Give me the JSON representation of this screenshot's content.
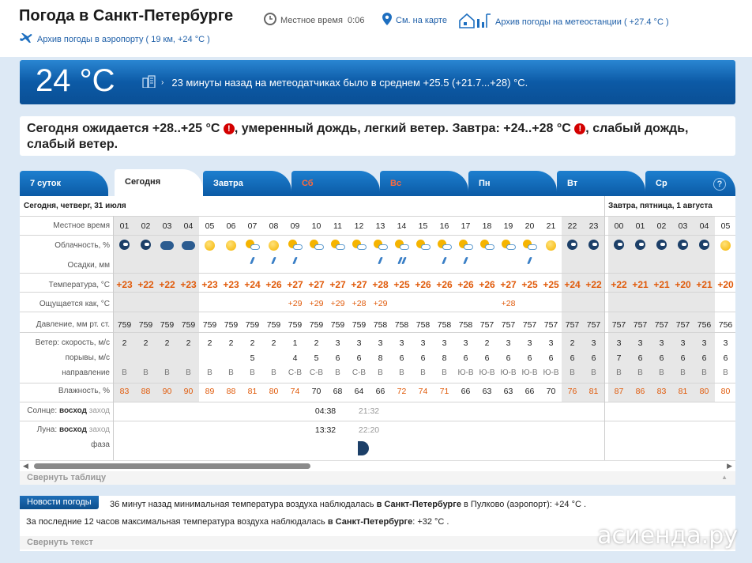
{
  "header": {
    "title": "Погода в Санкт-Петербурге",
    "local_time_label": "Местное время",
    "local_time": "0:06",
    "map_link": "См. на карте",
    "archive_station_link": "Архив погоды на метеостанции ( +27.4 °C )",
    "archive_airport_link": "Архив погоды в аэропорту ( 19 км, +24 °C )"
  },
  "current": {
    "temp": "24 °C",
    "message": "23 минуты назад на метеодатчиках было в среднем +25.5 (+21.7...+28) °C."
  },
  "forecast": {
    "part1": "Сегодня ожидается +28..+25 °C",
    "part2": ", умеренный дождь, легкий ветер. Завтра: +24..+28 °C",
    "part3": ", слабый дождь, слабый ветер.",
    "warn": "!"
  },
  "tabs": [
    {
      "label": "7 суток",
      "active": false,
      "red": false
    },
    {
      "label": "Сегодня",
      "active": true,
      "red": false
    },
    {
      "label": "Завтра",
      "active": false,
      "red": false
    },
    {
      "label": "Сб",
      "active": false,
      "red": true
    },
    {
      "label": "Вс",
      "active": false,
      "red": true
    },
    {
      "label": "Пн",
      "active": false,
      "red": false
    },
    {
      "label": "Вт",
      "active": false,
      "red": false
    },
    {
      "label": "Ср",
      "active": false,
      "red": false
    }
  ],
  "help": "?",
  "table": {
    "day1_header": "Сегодня, четверг, 31 июля",
    "day2_header": "Завтра, пятница, 1 августа",
    "labels": {
      "time": "Местное время",
      "clouds": "Облачность, %",
      "precip": "Осадки, мм",
      "temp": "Температура, °C",
      "feels": "Ощущается как, °C",
      "pressure": "Давление, мм рт. ст.",
      "wind_speed": "Ветер: скорость, м/с",
      "gusts": "порывы, м/с",
      "direction": "направление",
      "humidity": "Влажность, %",
      "sun_prefix": "Солнце:",
      "sun_rise": "восход",
      "sun_set": "заход",
      "moon_prefix": "Луна:",
      "moon_rise": "восход",
      "moon_set": "заход",
      "phase": "фаза"
    },
    "hours": [
      "01",
      "02",
      "03",
      "04",
      "05",
      "06",
      "07",
      "08",
      "09",
      "10",
      "11",
      "12",
      "13",
      "14",
      "15",
      "16",
      "17",
      "18",
      "19",
      "20",
      "21",
      "22",
      "23",
      "00",
      "01",
      "02",
      "03",
      "04",
      "05"
    ],
    "night_hours": [
      0,
      1,
      2,
      3,
      21,
      22,
      23,
      24,
      25,
      26,
      27
    ],
    "sky": [
      "moon",
      "moon",
      "cloud",
      "cloud",
      "sun",
      "sun",
      "sunc",
      "sun",
      "sunc",
      "sunc",
      "sunc",
      "sunc",
      "sunc",
      "sunc",
      "sunc",
      "sunc",
      "sunc",
      "sunc",
      "sunc",
      "sunc",
      "sun",
      "moon",
      "moon",
      "moon",
      "moon",
      "moon",
      "moon",
      "moon",
      "sun"
    ],
    "rain": [
      0,
      0,
      0,
      0,
      0,
      0,
      1,
      1,
      1,
      0,
      0,
      0,
      1,
      2,
      0,
      1,
      1,
      0,
      0,
      1,
      0,
      0,
      0,
      0,
      0,
      0,
      0,
      0,
      0
    ],
    "temps": [
      "+23",
      "+22",
      "+22",
      "+23",
      "+23",
      "+23",
      "+24",
      "+26",
      "+27",
      "+27",
      "+27",
      "+27",
      "+28",
      "+25",
      "+26",
      "+26",
      "+26",
      "+26",
      "+27",
      "+25",
      "+25",
      "+24",
      "+22",
      "+22",
      "+21",
      "+21",
      "+20",
      "+21",
      "+20"
    ],
    "feels": [
      "",
      "",
      "",
      "",
      "",
      "",
      "",
      "",
      "+29",
      "+29",
      "+29",
      "+28",
      "+29",
      "",
      "",
      "",
      "",
      "",
      "+28",
      "",
      "",
      "",
      "",
      "",
      "",
      "",
      "",
      "",
      ""
    ],
    "pressure": [
      "759",
      "759",
      "759",
      "759",
      "759",
      "759",
      "759",
      "759",
      "759",
      "759",
      "759",
      "759",
      "758",
      "758",
      "758",
      "758",
      "758",
      "757",
      "757",
      "757",
      "757",
      "757",
      "757",
      "757",
      "757",
      "757",
      "757",
      "756",
      "756"
    ],
    "wind": [
      "2",
      "2",
      "2",
      "2",
      "2",
      "2",
      "2",
      "2",
      "1",
      "2",
      "3",
      "3",
      "3",
      "3",
      "3",
      "3",
      "3",
      "2",
      "3",
      "3",
      "3",
      "2",
      "3",
      "3",
      "3",
      "3",
      "3",
      "3",
      "3"
    ],
    "gusts": [
      "",
      "",
      "",
      "",
      "",
      "",
      "5",
      "",
      "4",
      "5",
      "6",
      "6",
      "8",
      "6",
      "6",
      "8",
      "6",
      "6",
      "6",
      "6",
      "6",
      "6",
      "6",
      "7",
      "6",
      "6",
      "6",
      "6",
      "6"
    ],
    "dirs": [
      "В",
      "В",
      "В",
      "В",
      "В",
      "В",
      "В",
      "В",
      "С-В",
      "С-В",
      "В",
      "С-В",
      "В",
      "В",
      "В",
      "В",
      "Ю-В",
      "Ю-В",
      "Ю-В",
      "Ю-В",
      "Ю-В",
      "В",
      "В",
      "В",
      "В",
      "В",
      "В",
      "В",
      "В"
    ],
    "humidity": [
      "83",
      "88",
      "90",
      "90",
      "89",
      "88",
      "81",
      "80",
      "74",
      "70",
      "68",
      "64",
      "66",
      "72",
      "74",
      "71",
      "66",
      "63",
      "63",
      "66",
      "70",
      "76",
      "81",
      "87",
      "86",
      "83",
      "81",
      "80",
      "80"
    ],
    "humidity_orange": [
      1,
      1,
      1,
      1,
      1,
      1,
      1,
      1,
      1,
      0,
      0,
      0,
      0,
      1,
      1,
      1,
      0,
      0,
      0,
      0,
      0,
      1,
      1,
      1,
      1,
      1,
      1,
      1,
      1
    ],
    "sunrise": "04:38",
    "sunset": "21:32",
    "moonrise": "13:32",
    "moonset": "22:20"
  },
  "collapse_table": "Свернуть таблицу",
  "news": {
    "badge": "Новости погоды",
    "l1_pre": "36 минут назад минимальная температура воздуха наблюдалась",
    "l1_city": "в Санкт-Петербурге",
    "l1_post": "в Пулково (аэропорт): +24 °C .",
    "l2_pre": "За последние 12 часов максимальная температура воздуха наблюдалась",
    "l2_city": "в Санкт-Петербурге",
    "l2_post": ": +32 °C .",
    "collapse": "Свернуть текст"
  },
  "watermark": "асиенда.ру",
  "colors": {
    "accent": "#0b5aa5",
    "warm": "#e05a0a",
    "link": "#1e5fa8"
  }
}
